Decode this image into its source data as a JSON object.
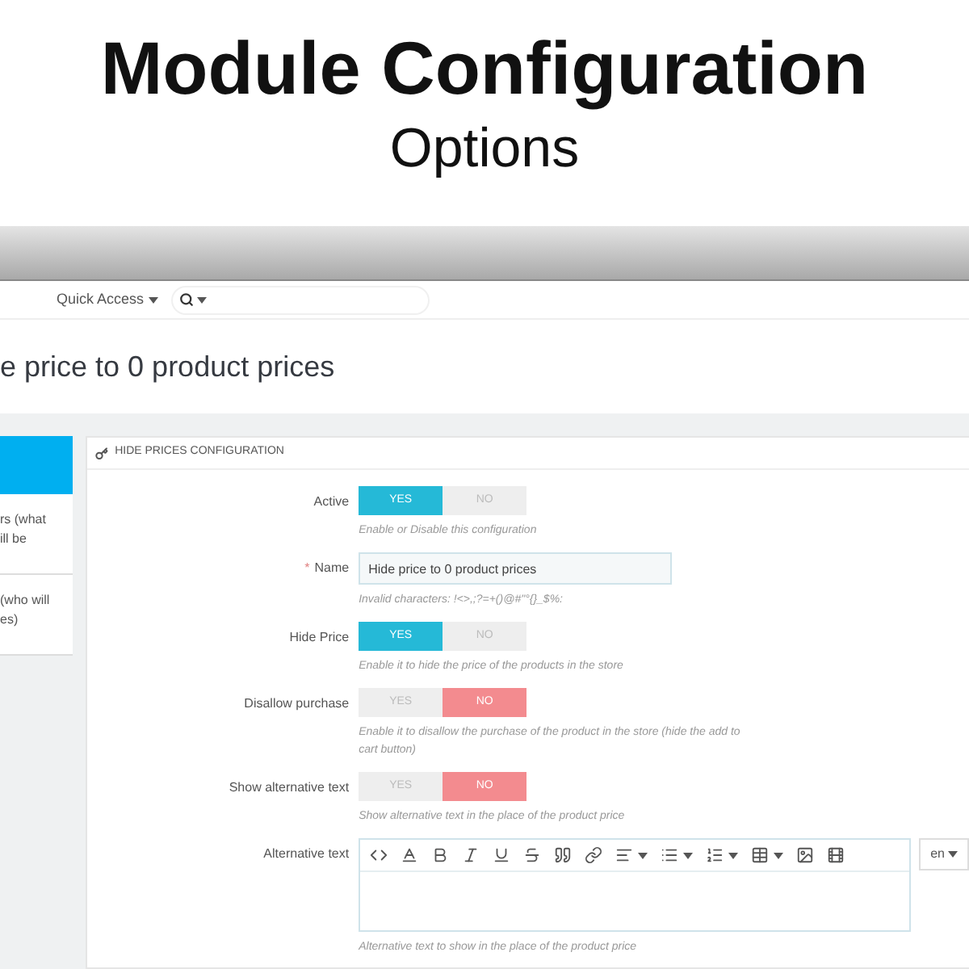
{
  "banner": {
    "title": "Module Configuration",
    "subtitle": "Options"
  },
  "header": {
    "quick_access": "Quick Access"
  },
  "page_title": "e price to 0 product prices",
  "sidebar": {
    "items": [
      {
        "selected": true
      },
      {
        "lines": [
          "rs (what",
          "ill be"
        ],
        "selected": false
      },
      {
        "lines": [
          "(who will",
          "es)"
        ],
        "selected": false
      }
    ]
  },
  "panel": {
    "title": "HIDE PRICES CONFIGURATION",
    "fields": [
      {
        "kind": "switch",
        "label": "Active",
        "yes": "YES",
        "no": "NO",
        "on": true,
        "help": "Enable or Disable this configuration"
      },
      {
        "kind": "text",
        "label": "Name",
        "required_mark": "*",
        "value": "Hide price to 0 product prices",
        "help": "Invalid characters: !<>,;?=+()@#\"°{}_$%:"
      },
      {
        "kind": "switch",
        "label": "Hide Price",
        "yes": "YES",
        "no": "NO",
        "on": true,
        "help": "Enable it to hide the price of the products in the store"
      },
      {
        "kind": "switch",
        "label": "Disallow purchase",
        "yes": "YES",
        "no": "NO",
        "on": false,
        "help": "Enable it to disallow the purchase of the product in the store (hide the add to cart button)"
      },
      {
        "kind": "switch",
        "label": "Show alternative text",
        "yes": "YES",
        "no": "NO",
        "on": false,
        "help": "Show alternative text in the place of the product price"
      },
      {
        "kind": "editor",
        "label": "Alternative text",
        "language": "en",
        "help": "Alternative text to show in the place of the product price"
      }
    ]
  }
}
